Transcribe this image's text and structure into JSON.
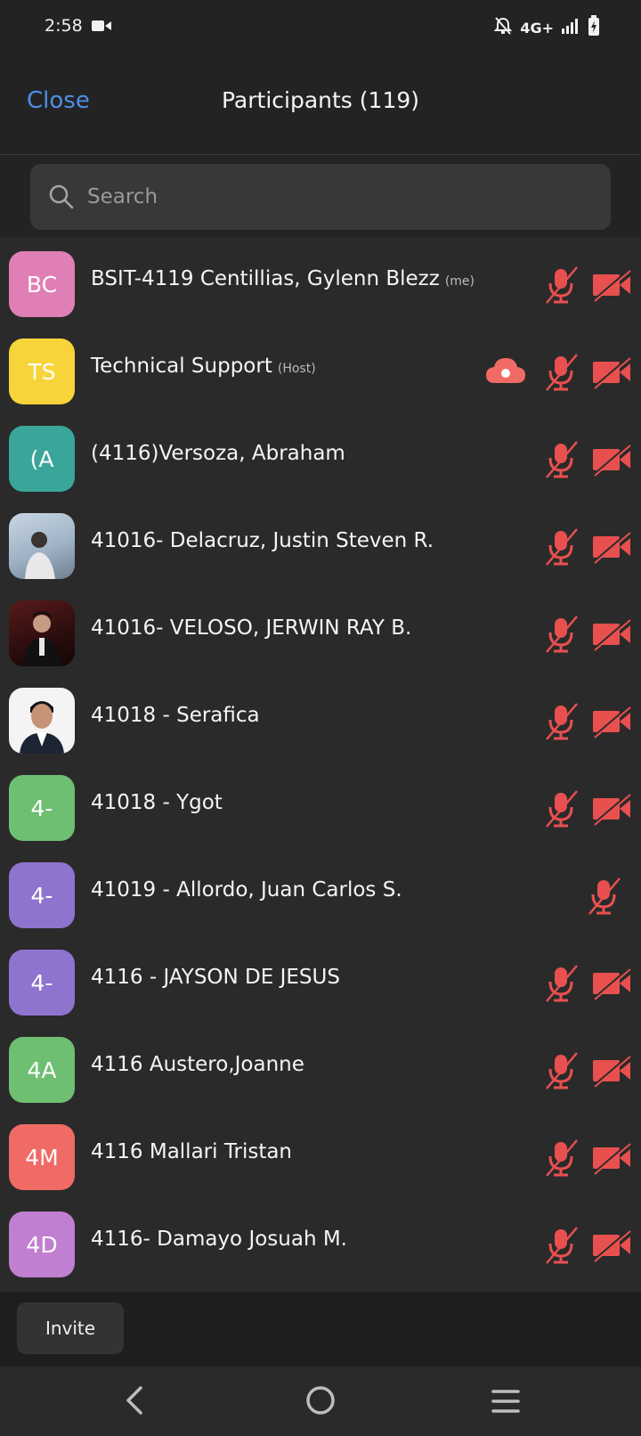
{
  "status_bar": {
    "time": "2:58",
    "network": "4G+"
  },
  "header": {
    "close_label": "Close",
    "title": "Participants (119)"
  },
  "search": {
    "placeholder": "Search"
  },
  "colors": {
    "accent": "#4f8ee8",
    "muted_red": "#e8504f"
  },
  "participants": [
    {
      "initials": "BC",
      "name": "BSIT-4119 Centillias, Gylenn Blezz",
      "tag": "(me)",
      "avatar_color": "#e07fb6",
      "mic": "muted",
      "video": "off"
    },
    {
      "initials": "TS",
      "name": "Technical Support",
      "tag": "(Host)",
      "avatar_color": "#f7d43a",
      "recording": true,
      "mic": "muted",
      "video": "off"
    },
    {
      "initials": "(A",
      "name": "(4116)Versoza, Abraham",
      "tag": "",
      "avatar_color": "#3aa69a",
      "mic": "muted",
      "video": "off"
    },
    {
      "initials": "",
      "name": "41016- Delacruz, Justin Steven R.",
      "tag": "",
      "avatar_photo": "photo-avatar",
      "mic": "muted",
      "video": "off"
    },
    {
      "initials": "",
      "name": "41016- VELOSO, JERWIN RAY B.",
      "tag": "",
      "avatar_photo": "photo-avatar",
      "mic": "muted",
      "video": "off"
    },
    {
      "initials": "",
      "name": "41018 - Serafica",
      "tag": "",
      "avatar_photo": "photo-avatar",
      "mic": "muted",
      "video": "off"
    },
    {
      "initials": "4-",
      "name": "41018 - Ygot",
      "tag": "",
      "avatar_color": "#6fbf73",
      "mic": "muted",
      "video": "off"
    },
    {
      "initials": "4-",
      "name": "41019 - Allordo, Juan Carlos S.",
      "tag": "",
      "avatar_color": "#8e74cf",
      "mic": "muted",
      "video": "none"
    },
    {
      "initials": "4-",
      "name": "4116 - JAYSON DE JESUS",
      "tag": "",
      "avatar_color": "#8e74cf",
      "mic": "muted",
      "video": "off"
    },
    {
      "initials": "4A",
      "name": "4116 Austero,Joanne",
      "tag": "",
      "avatar_color": "#6fbf73",
      "mic": "muted",
      "video": "off"
    },
    {
      "initials": "4M",
      "name": "4116 Mallari Tristan",
      "tag": "",
      "avatar_color": "#f06b65",
      "mic": "muted",
      "video": "off"
    },
    {
      "initials": "4D",
      "name": "4116- Damayo Josuah M.",
      "tag": "",
      "avatar_color": "#c07fd0",
      "mic": "muted",
      "video": "off"
    }
  ],
  "footer": {
    "invite_label": "Invite"
  }
}
